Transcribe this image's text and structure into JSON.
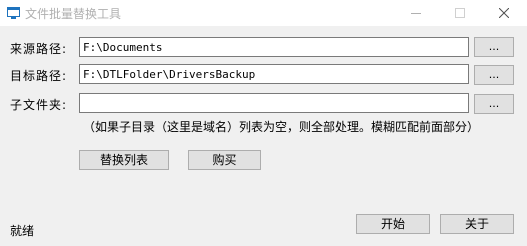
{
  "window": {
    "title": "文件批量替换工具",
    "accent_color": "#0078d7"
  },
  "form": {
    "source": {
      "label": "来源路径:",
      "value": "F:\\Documents",
      "browse_label": "..."
    },
    "target": {
      "label": "目标路径:",
      "value": "F:\\DTLFolder\\DriversBackup",
      "browse_label": "..."
    },
    "subfolder": {
      "label": "子文件夹:",
      "value": "",
      "browse_label": "..."
    },
    "hint": "（如果子目录（这里是域名）列表为空，则全部处理。模糊匹配前面部分）"
  },
  "actions": {
    "replace_list_label": "替换列表",
    "buy_label": "购买",
    "start_label": "开始",
    "about_label": "关于"
  },
  "status": {
    "text": "就绪"
  },
  "icons": {
    "app": "window-icon",
    "minimize": "minimize-icon",
    "maximize": "maximize-icon",
    "close": "close-icon"
  }
}
